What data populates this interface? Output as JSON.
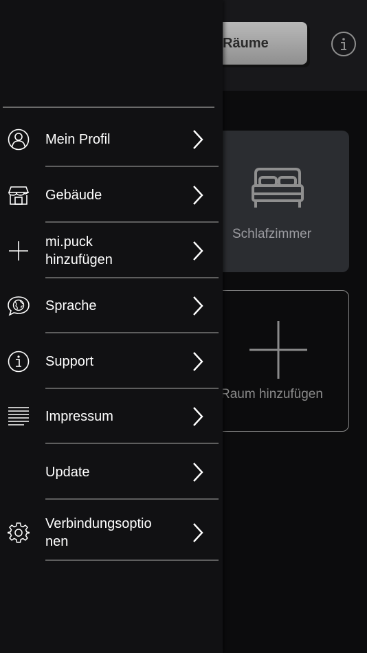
{
  "background": {
    "tab_label": "Räume",
    "room_card_label": "Schlafzimmer",
    "add_room_label": "Raum hinzufügen"
  },
  "menu": {
    "items": [
      {
        "label": "Mein Profil",
        "icon": "profile-icon"
      },
      {
        "label": "Gebäude",
        "icon": "building-icon"
      },
      {
        "label": "mi.puck\nhinzufügen",
        "icon": "plus-icon"
      },
      {
        "label": "Sprache",
        "icon": "language-icon"
      },
      {
        "label": "Support",
        "icon": "info-icon"
      },
      {
        "label": "Impressum",
        "icon": "list-icon"
      },
      {
        "label": "Update",
        "icon": ""
      },
      {
        "label": "Verbindungsoptio\nnen",
        "icon": "gear-icon"
      }
    ]
  },
  "colors": {
    "drawer_bg": "#111113",
    "separator": "#5e5e5e",
    "card_bg": "#2b2d31"
  }
}
